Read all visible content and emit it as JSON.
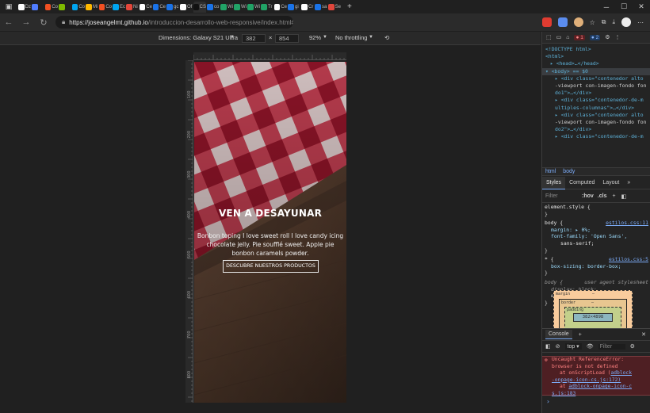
{
  "browser": {
    "tabs": [
      {
        "label": "Dz",
        "color": "#ffffff"
      },
      {
        "label": "",
        "color": "#4f7cff"
      },
      {
        "label": "Co",
        "color": "#f25022"
      },
      {
        "label": "",
        "color": "#7fba00"
      },
      {
        "label": "Co",
        "color": "#00a4ef"
      },
      {
        "label": "Mi",
        "color": "#ffb900"
      },
      {
        "label": "Co",
        "color": "#f25022"
      },
      {
        "label": "Ec",
        "color": "#00a4ef"
      },
      {
        "label": "Ni",
        "color": "#e4473b"
      },
      {
        "label": "Ce",
        "color": "#ffffff"
      },
      {
        "label": "Ce",
        "color": "#1a73e8"
      },
      {
        "label": "gc",
        "color": "#1a73e8"
      },
      {
        "label": "Of",
        "color": "#ffffff"
      },
      {
        "label": "CS",
        "color": "#111111"
      },
      {
        "label": "co",
        "color": "#1a73e8"
      },
      {
        "label": "Wi",
        "color": "#21a366"
      },
      {
        "label": "Wi",
        "color": "#21a366"
      },
      {
        "label": "Wi",
        "color": "#21a366"
      },
      {
        "label": "Tr",
        "color": "#21a366"
      },
      {
        "label": "Ce",
        "color": "#ffffff"
      },
      {
        "label": "gi",
        "color": "#1a73e8"
      },
      {
        "label": "Cr",
        "color": "#ffffff"
      },
      {
        "label": "sa",
        "color": "#1a73e8"
      },
      {
        "label": "Se",
        "color": "#e0463c"
      }
    ],
    "active_tab_index": 13,
    "address": {
      "host": "https://joseangelmt.github.io",
      "path": "/introduccion-desarrollo-web-responsive/index.html#"
    }
  },
  "device_toolbar": {
    "dimensions_label": "Dimensions: Galaxy S21 Ultra",
    "width": "382",
    "times": "×",
    "height": "854",
    "zoom": "92%",
    "throttling": "No throttling"
  },
  "ruler": {
    "top_ticks": [
      "100",
      "200",
      "300"
    ],
    "left_ticks": [
      "100",
      "200",
      "300",
      "400",
      "500",
      "600",
      "700",
      "800"
    ]
  },
  "page": {
    "hero_title": "VEN A DESAYUNAR",
    "hero_text": "Bonbon toping I love sweet roll I love candy icing chocolate jelly. Pie soufflé sweet. Apple pie bonbon caramels powder.",
    "hero_button": "DESCUBRE NUESTROS PRODUCTOS"
  },
  "devtools": {
    "error_count": "1",
    "info_count": "2",
    "dom_lines": [
      {
        "text": "<!DOCTYPE html>",
        "indent": 0
      },
      {
        "text": "<html>",
        "indent": 0
      },
      {
        "text": "▸ <head>…</head>",
        "indent": 1
      },
      {
        "text": "▾ <body> == $0",
        "indent": 0
      },
      {
        "text": "▸ <div class=\"contenedor alto",
        "indent": 2
      },
      {
        "text": "-viewport con-imagen-fondo fon",
        "indent": 2
      },
      {
        "text": "do1\">…</div>",
        "indent": 2
      },
      {
        "text": "▸ <div class=\"contenedor-de-m",
        "indent": 2
      },
      {
        "text": "ultiples-columnas\">…</div>",
        "indent": 2
      },
      {
        "text": "▸ <div class=\"contenedor alto",
        "indent": 2
      },
      {
        "text": "-viewport con-imagen-fondo fon",
        "indent": 2
      },
      {
        "text": "do2\">…</div>",
        "indent": 2
      },
      {
        "text": "▸ <div class=\"contenedor-de-m",
        "indent": 2
      }
    ],
    "breadcrumbs": [
      "html",
      "body"
    ],
    "panel_tabs": [
      "Styles",
      "Computed",
      "Layout",
      "»"
    ],
    "filter_placeholder": "Filter",
    "hov": ":hov",
    "cls": ".cls",
    "styles": {
      "element_style": "element.style {",
      "close": "}",
      "body_sel": "body {",
      "body_src": "estilos.css:11",
      "margin": "margin: ▸ 0%;",
      "font_family": "font-family: 'Open Sans',",
      "font_family2": "sans-serif;",
      "star_sel": "* {",
      "star_src": "estilos.css:5",
      "box_sizing": "box-sizing: border-box;",
      "ua_sel": "body {",
      "ua_label": "user agent stylesheet",
      "display": "display: block;",
      "ua_margin": "margin:▸ 8px;"
    },
    "box_model": {
      "margin": "margin",
      "border": "border",
      "padding": "padding",
      "dash": "–",
      "content": "382×4898"
    },
    "console": {
      "title": "Console",
      "context": "top ▾",
      "filter_placeholder": "Filter",
      "error_line1": "Uncaught ReferenceError:",
      "error_line2": "browser is not defined",
      "error_line3": "at onScriptLoad (",
      "error_link1": "adblock",
      "error_line4": "-onpage-icon-cs.js:172)",
      "error_line5": "at ",
      "error_link2": "adblock-onpage-icon-c",
      "error_line6": "s.js:183",
      "prompt": "›"
    }
  }
}
